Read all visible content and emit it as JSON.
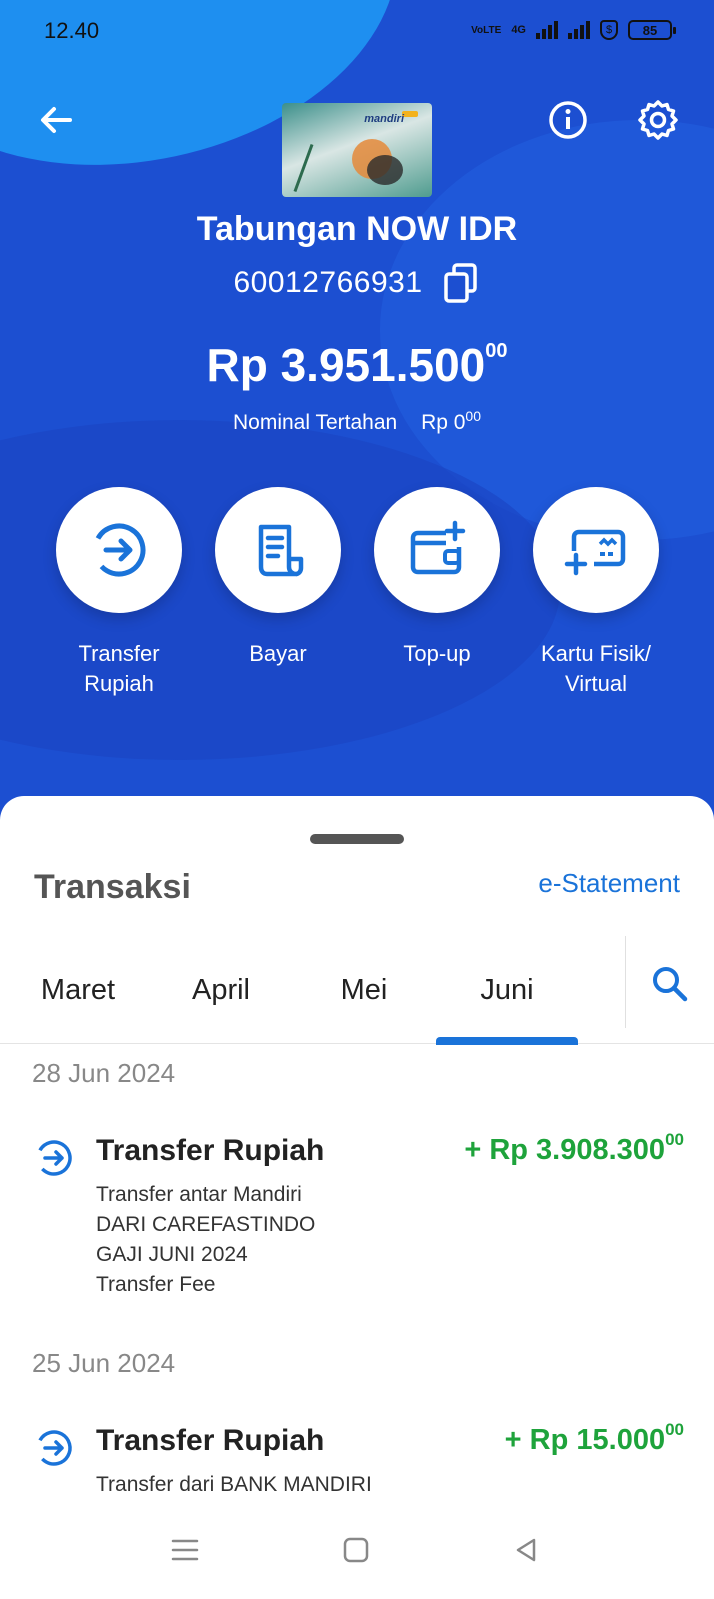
{
  "status_bar": {
    "time": "12.40",
    "network_label": "VoLTE",
    "network_type": "4G",
    "battery": "85"
  },
  "header": {
    "card_brand": "mandiri"
  },
  "account": {
    "name": "Tabungan NOW IDR",
    "number": "60012766931",
    "balance_main": "Rp 3.951.500",
    "balance_decimal": "00",
    "held_label": "Nominal Tertahan",
    "held_amount": "Rp 0",
    "held_decimal": "00"
  },
  "actions": [
    {
      "label": "Transfer\nRupiah",
      "icon": "transfer-icon"
    },
    {
      "label": "Bayar",
      "icon": "bill-icon"
    },
    {
      "label": "Top-up",
      "icon": "wallet-add-icon"
    },
    {
      "label": "Kartu Fisik/\nVirtual",
      "icon": "card-add-icon"
    }
  ],
  "transactions_section": {
    "title": "Transaksi",
    "estatement_label": "e-Statement",
    "tabs": [
      "Maret",
      "April",
      "Mei",
      "Juni"
    ],
    "active_tab": "Juni"
  },
  "transactions": [
    {
      "date": "28 Jun 2024",
      "title": "Transfer Rupiah",
      "amount": "+ Rp 3.908.300",
      "amount_decimal": "00",
      "description": [
        "Transfer antar Mandiri",
        "DARI CAREFASTINDO",
        "GAJI JUNI 2024",
        "Transfer Fee"
      ]
    },
    {
      "date": "25 Jun 2024",
      "title": "Transfer Rupiah",
      "amount": "+ Rp 15.000",
      "amount_decimal": "00",
      "description": [
        "Transfer dari BANK MANDIRI"
      ]
    }
  ],
  "colors": {
    "hero_blue": "#1c4fd1",
    "accent_blue": "#1a73d9",
    "credit_green": "#1ea33b"
  }
}
